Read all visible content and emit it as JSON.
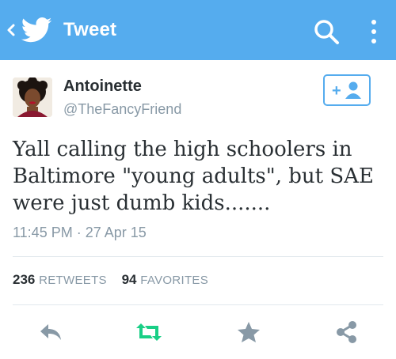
{
  "appbar": {
    "title": "Tweet",
    "background": "#55acee",
    "icons": [
      "chevron-left-icon",
      "twitter-bird-icon",
      "search-icon",
      "overflow-menu-icon"
    ]
  },
  "tweet": {
    "author": {
      "display_name": "Antoinette",
      "handle": "@TheFancyFriend"
    },
    "follow_button_label": "+",
    "text_lines": [
      "Yall calling the high schoolers in",
      "Baltimore \"young adults\", but SAE",
      "were just dumb kids......."
    ],
    "timestamp": "11:45 PM · 27 Apr 15",
    "stats": {
      "retweets_count": "236",
      "retweets_label": "RETWEETS",
      "favorites_count": "94",
      "favorites_label": "FAVORITES"
    }
  },
  "actions": {
    "icons": [
      "reply-icon",
      "retweet-icon",
      "favorite-star-icon",
      "share-icon"
    ],
    "retweet_color": "#19cf86",
    "icon_color": "#8899a6"
  }
}
